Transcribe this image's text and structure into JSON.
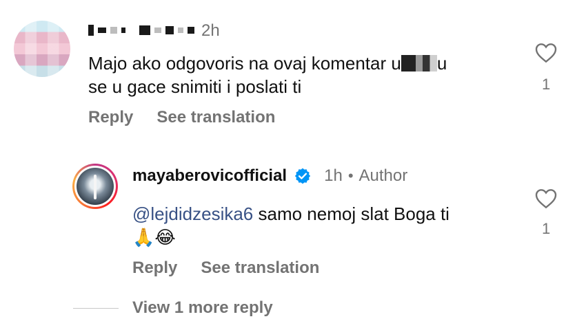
{
  "comment1": {
    "time": "2h",
    "text_part1": "Majo ako odgovoris na ovaj komentar u",
    "text_part2": "u",
    "text_line2": "se u gace snimiti i poslati ti",
    "likes": "1",
    "reply_label": "Reply",
    "translate_label": "See translation"
  },
  "comment2": {
    "username": "mayaberovicofficial",
    "time": "1h",
    "dot": "•",
    "author_label": "Author",
    "mention": "@lejdidzesika6",
    "text": " samo nemoj slat Boga ti",
    "emojis": "🙏😂",
    "likes": "1",
    "reply_label": "Reply",
    "translate_label": "See translation"
  },
  "view_more_label": "View 1 more reply",
  "colors": {
    "muted": "#737373",
    "mention": "#385185",
    "verified": "#0095f6"
  }
}
